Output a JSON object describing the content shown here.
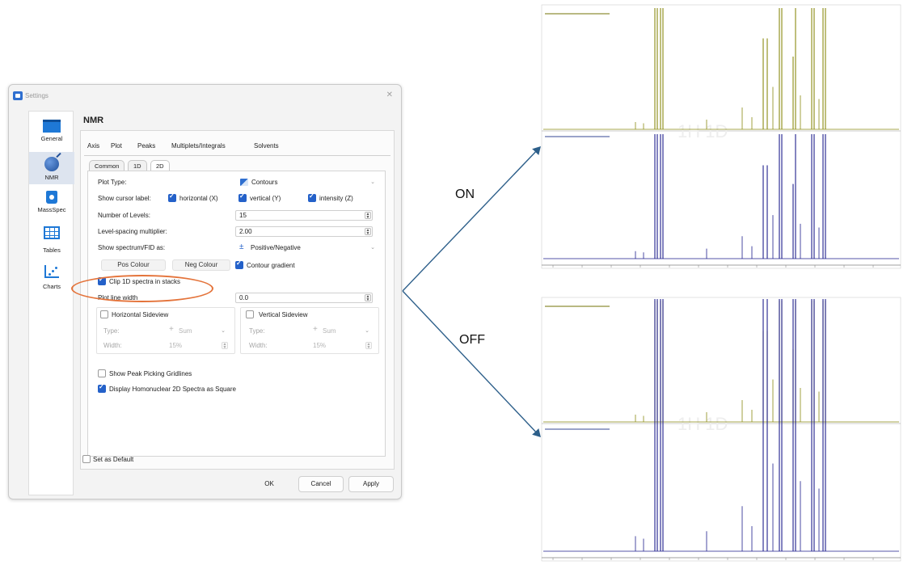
{
  "dialog": {
    "title": "Settings",
    "close_glyph": "✕",
    "section_title": "NMR",
    "sidebar": [
      {
        "label": "General",
        "icon": "general-icon"
      },
      {
        "label": "NMR",
        "icon": "nmr-icon",
        "active": true
      },
      {
        "label": "MassSpec",
        "icon": "massspec-icon"
      },
      {
        "label": "Tables",
        "icon": "tables-icon"
      },
      {
        "label": "Charts",
        "icon": "charts-icon"
      }
    ],
    "tabs": [
      "Axis",
      "Plot",
      "Peaks",
      "Multiplets/Integrals",
      "Solvents"
    ],
    "active_tab": "Plot",
    "subtabs": [
      "Common",
      "1D",
      "2D"
    ],
    "active_subtab": "2D",
    "plot_type": {
      "label": "Plot Type:",
      "value": "Contours"
    },
    "cursor_label": {
      "label": "Show cursor label:",
      "horizontal": "horizontal (X)",
      "vertical": "vertical (Y)",
      "intensity": "intensity (Z)"
    },
    "levels": {
      "label": "Number of Levels:",
      "value": "15"
    },
    "spacing": {
      "label": "Level-spacing multiplier:",
      "value": "2.00"
    },
    "show_as": {
      "label": "Show spectrum/FID as:",
      "value": "Positive/Negative"
    },
    "pos_colour": "Pos Colour",
    "neg_colour": "Neg Colour",
    "contour_gradient": "Contour gradient",
    "clip": "Clip 1D spectra in stacks",
    "plot_line_width": {
      "label": "Plot line width",
      "value": "0.0"
    },
    "h_sideview": {
      "label": "Horizontal Sideview",
      "type_label": "Type:",
      "type_value": "Sum",
      "width_label": "Width:",
      "width_value": "15%"
    },
    "v_sideview": {
      "label": "Vertical Sideview",
      "type_label": "Type:",
      "type_value": "Sum",
      "width_label": "Width:",
      "width_value": "15%"
    },
    "gridlines": "Show Peak Picking Gridlines",
    "square": "Display Homonuclear 2D Spectra as Square",
    "set_default": "Set as Default",
    "ok": "OK",
    "cancel": "Cancel",
    "apply": "Apply"
  },
  "annotations": {
    "on": "ON",
    "off": "OFF"
  },
  "colors": {
    "accent": "#2461c9",
    "highlight": "#e4733a",
    "arrow": "#2d5f8a",
    "olive": "#8a8a12",
    "navy": "#1e1e8c"
  },
  "spectra": [
    {
      "id": "on",
      "mode": "clipped",
      "watermark": "1H 1D"
    },
    {
      "id": "off",
      "mode": "unclipped",
      "watermark": "1H 1D"
    }
  ]
}
